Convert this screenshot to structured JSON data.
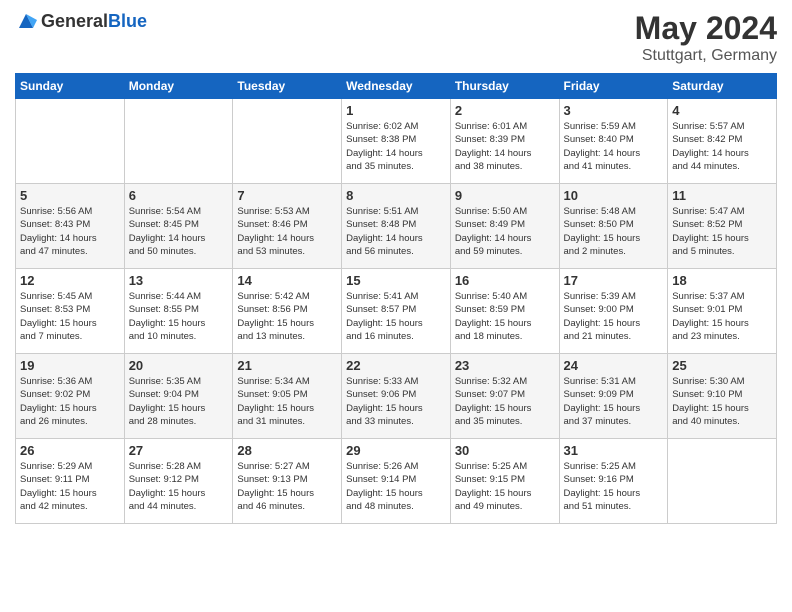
{
  "header": {
    "logo_general": "General",
    "logo_blue": "Blue",
    "month_title": "May 2024",
    "subtitle": "Stuttgart, Germany"
  },
  "days_of_week": [
    "Sunday",
    "Monday",
    "Tuesday",
    "Wednesday",
    "Thursday",
    "Friday",
    "Saturday"
  ],
  "weeks": [
    [
      {
        "day": "",
        "info": ""
      },
      {
        "day": "",
        "info": ""
      },
      {
        "day": "",
        "info": ""
      },
      {
        "day": "1",
        "info": "Sunrise: 6:02 AM\nSunset: 8:38 PM\nDaylight: 14 hours\nand 35 minutes."
      },
      {
        "day": "2",
        "info": "Sunrise: 6:01 AM\nSunset: 8:39 PM\nDaylight: 14 hours\nand 38 minutes."
      },
      {
        "day": "3",
        "info": "Sunrise: 5:59 AM\nSunset: 8:40 PM\nDaylight: 14 hours\nand 41 minutes."
      },
      {
        "day": "4",
        "info": "Sunrise: 5:57 AM\nSunset: 8:42 PM\nDaylight: 14 hours\nand 44 minutes."
      }
    ],
    [
      {
        "day": "5",
        "info": "Sunrise: 5:56 AM\nSunset: 8:43 PM\nDaylight: 14 hours\nand 47 minutes."
      },
      {
        "day": "6",
        "info": "Sunrise: 5:54 AM\nSunset: 8:45 PM\nDaylight: 14 hours\nand 50 minutes."
      },
      {
        "day": "7",
        "info": "Sunrise: 5:53 AM\nSunset: 8:46 PM\nDaylight: 14 hours\nand 53 minutes."
      },
      {
        "day": "8",
        "info": "Sunrise: 5:51 AM\nSunset: 8:48 PM\nDaylight: 14 hours\nand 56 minutes."
      },
      {
        "day": "9",
        "info": "Sunrise: 5:50 AM\nSunset: 8:49 PM\nDaylight: 14 hours\nand 59 minutes."
      },
      {
        "day": "10",
        "info": "Sunrise: 5:48 AM\nSunset: 8:50 PM\nDaylight: 15 hours\nand 2 minutes."
      },
      {
        "day": "11",
        "info": "Sunrise: 5:47 AM\nSunset: 8:52 PM\nDaylight: 15 hours\nand 5 minutes."
      }
    ],
    [
      {
        "day": "12",
        "info": "Sunrise: 5:45 AM\nSunset: 8:53 PM\nDaylight: 15 hours\nand 7 minutes."
      },
      {
        "day": "13",
        "info": "Sunrise: 5:44 AM\nSunset: 8:55 PM\nDaylight: 15 hours\nand 10 minutes."
      },
      {
        "day": "14",
        "info": "Sunrise: 5:42 AM\nSunset: 8:56 PM\nDaylight: 15 hours\nand 13 minutes."
      },
      {
        "day": "15",
        "info": "Sunrise: 5:41 AM\nSunset: 8:57 PM\nDaylight: 15 hours\nand 16 minutes."
      },
      {
        "day": "16",
        "info": "Sunrise: 5:40 AM\nSunset: 8:59 PM\nDaylight: 15 hours\nand 18 minutes."
      },
      {
        "day": "17",
        "info": "Sunrise: 5:39 AM\nSunset: 9:00 PM\nDaylight: 15 hours\nand 21 minutes."
      },
      {
        "day": "18",
        "info": "Sunrise: 5:37 AM\nSunset: 9:01 PM\nDaylight: 15 hours\nand 23 minutes."
      }
    ],
    [
      {
        "day": "19",
        "info": "Sunrise: 5:36 AM\nSunset: 9:02 PM\nDaylight: 15 hours\nand 26 minutes."
      },
      {
        "day": "20",
        "info": "Sunrise: 5:35 AM\nSunset: 9:04 PM\nDaylight: 15 hours\nand 28 minutes."
      },
      {
        "day": "21",
        "info": "Sunrise: 5:34 AM\nSunset: 9:05 PM\nDaylight: 15 hours\nand 31 minutes."
      },
      {
        "day": "22",
        "info": "Sunrise: 5:33 AM\nSunset: 9:06 PM\nDaylight: 15 hours\nand 33 minutes."
      },
      {
        "day": "23",
        "info": "Sunrise: 5:32 AM\nSunset: 9:07 PM\nDaylight: 15 hours\nand 35 minutes."
      },
      {
        "day": "24",
        "info": "Sunrise: 5:31 AM\nSunset: 9:09 PM\nDaylight: 15 hours\nand 37 minutes."
      },
      {
        "day": "25",
        "info": "Sunrise: 5:30 AM\nSunset: 9:10 PM\nDaylight: 15 hours\nand 40 minutes."
      }
    ],
    [
      {
        "day": "26",
        "info": "Sunrise: 5:29 AM\nSunset: 9:11 PM\nDaylight: 15 hours\nand 42 minutes."
      },
      {
        "day": "27",
        "info": "Sunrise: 5:28 AM\nSunset: 9:12 PM\nDaylight: 15 hours\nand 44 minutes."
      },
      {
        "day": "28",
        "info": "Sunrise: 5:27 AM\nSunset: 9:13 PM\nDaylight: 15 hours\nand 46 minutes."
      },
      {
        "day": "29",
        "info": "Sunrise: 5:26 AM\nSunset: 9:14 PM\nDaylight: 15 hours\nand 48 minutes."
      },
      {
        "day": "30",
        "info": "Sunrise: 5:25 AM\nSunset: 9:15 PM\nDaylight: 15 hours\nand 49 minutes."
      },
      {
        "day": "31",
        "info": "Sunrise: 5:25 AM\nSunset: 9:16 PM\nDaylight: 15 hours\nand 51 minutes."
      },
      {
        "day": "",
        "info": ""
      }
    ]
  ]
}
